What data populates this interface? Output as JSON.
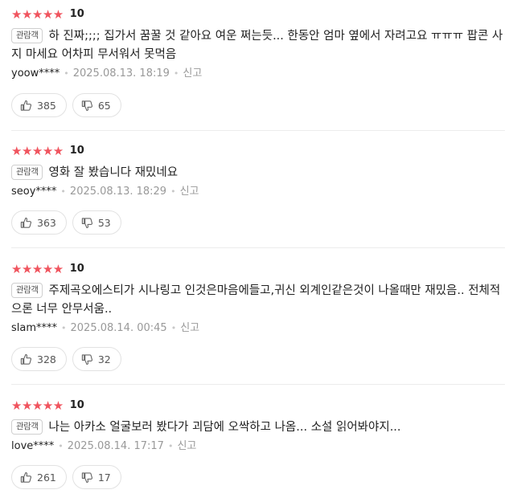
{
  "reviews": [
    {
      "stars": "★★★★★",
      "score": "10",
      "badge": "관람객",
      "text": "하 진짜;;;; 집가서 꿈꿀 것 같아요 여운 쩌는듯... 한동안 엄마 옆에서 자려고요 ㅠㅠㅠ 팝콘 사지 마세요 어차피 무서워서 못먹음",
      "user": "yoow****",
      "date": "2025.08.13. 18:19",
      "report": "신고",
      "likes": "385",
      "dislikes": "65"
    },
    {
      "stars": "★★★★★",
      "score": "10",
      "badge": "관람객",
      "text": "영화 잘 봤습니다 재밌네요",
      "user": "seoy****",
      "date": "2025.08.13. 18:29",
      "report": "신고",
      "likes": "363",
      "dislikes": "53"
    },
    {
      "stars": "★★★★★",
      "score": "10",
      "badge": "관람객",
      "text": "주제곡오에스티가 시나링고 인것은마음에들고,귀신 외계인같은것이 나올때만 재밌음.. 전체적으론 너무 안무서움..",
      "user": "slam****",
      "date": "2025.08.14. 00:45",
      "report": "신고",
      "likes": "328",
      "dislikes": "32"
    },
    {
      "stars": "★★★★★",
      "score": "10",
      "badge": "관람객",
      "text": "나는 아카소 얼굴보러 봤다가 괴담에 오싹하고 나옴... 소설 읽어봐야지...",
      "user": "love****",
      "date": "2025.08.14. 17:17",
      "report": "신고",
      "likes": "261",
      "dislikes": "17"
    }
  ]
}
